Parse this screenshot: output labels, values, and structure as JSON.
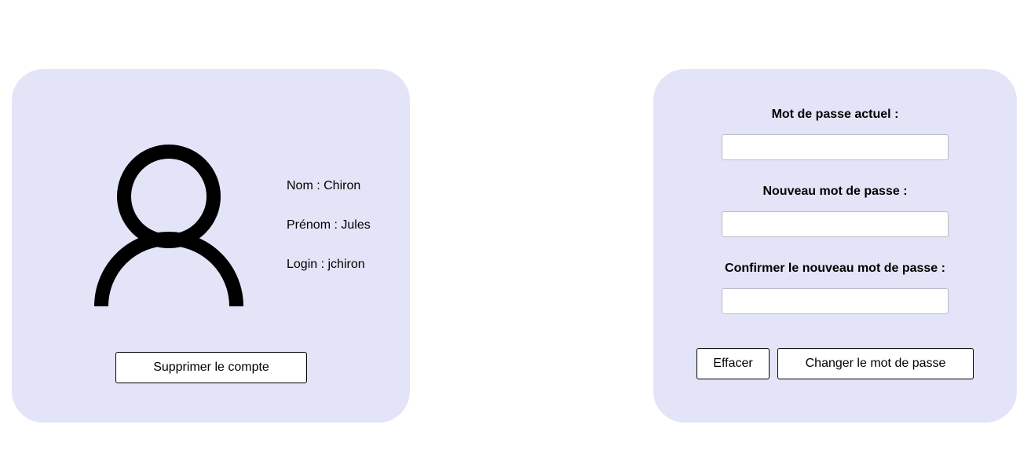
{
  "profile": {
    "avatar_icon": "user-icon",
    "nom": "Nom : Chiron",
    "prenom": "Prénom : Jules",
    "login": "Login : jchiron",
    "delete_label": "Supprimer le compte"
  },
  "password_form": {
    "current_label": "Mot de passe actuel :",
    "current_value": "",
    "new_label": "Nouveau mot de passe :",
    "new_value": "",
    "confirm_label": "Confirmer le nouveau mot de passe :",
    "confirm_value": "",
    "clear_label": "Effacer",
    "change_label": "Changer le mot de passe"
  },
  "colors": {
    "card_background": "#e4e4f8",
    "page_background": "#ffffff"
  }
}
